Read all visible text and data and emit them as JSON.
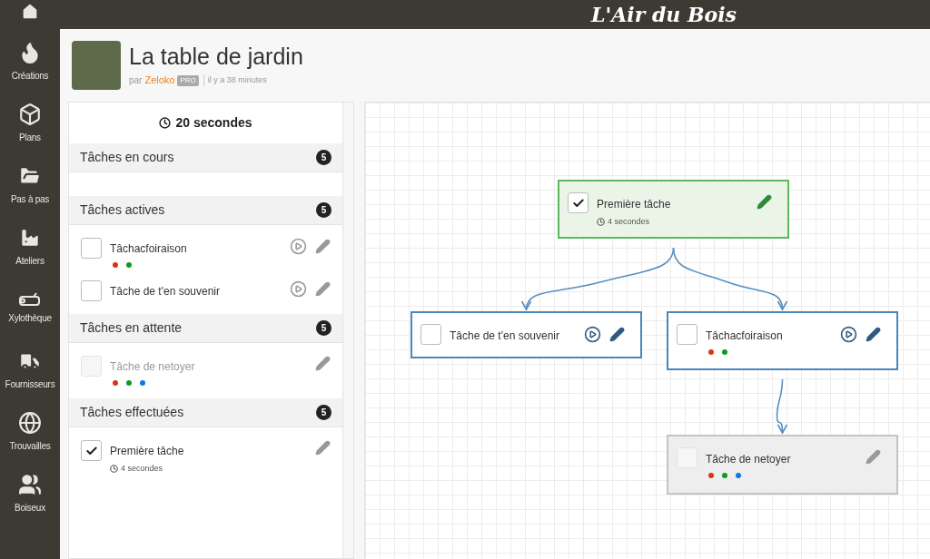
{
  "topbar": {
    "logo": "L'Air du Bois"
  },
  "sidebar": {
    "items": [
      {
        "kind": "home"
      },
      {
        "kind": "flame",
        "label": "Créations"
      },
      {
        "kind": "box",
        "label": "Plans"
      },
      {
        "kind": "folder",
        "label": "Pas à pas"
      },
      {
        "kind": "factory",
        "label": "Ateliers"
      },
      {
        "kind": "log",
        "label": "Xylothèque"
      },
      {
        "kind": "truck",
        "label": "Fournisseurs"
      },
      {
        "kind": "globe",
        "label": "Trouvailles"
      },
      {
        "kind": "users",
        "label": "Boiseux"
      }
    ]
  },
  "project": {
    "title": "La table de jardin",
    "by": "par",
    "author": "Zeloko",
    "badge": "PRO",
    "time": "il y a 38 minutes"
  },
  "timer": "20 secondes",
  "sections": [
    {
      "title": "Tâches en cours",
      "count": "5"
    },
    {
      "title": "Tâches actives",
      "count": "5",
      "tasks": [
        {
          "name": "Tâchacfoiraison",
          "kind": "active",
          "checked": false,
          "dots": [
            {
              "color": "#dd3311"
            },
            {
              "color": "#119922"
            }
          ]
        },
        {
          "name": "Tâche de t'en souvenir",
          "kind": "active",
          "checked": false
        }
      ]
    },
    {
      "title": "Tâches en attente",
      "count": "5",
      "tasks": [
        {
          "name": "Tâche de netoyer",
          "kind": "pending",
          "checked": false,
          "dots": [
            {
              "color": "#dd3311"
            },
            {
              "color": "#119922"
            },
            {
              "color": "#1177dd"
            }
          ]
        }
      ]
    },
    {
      "title": "Tâches effectuées",
      "count": "5",
      "tasks": [
        {
          "name": "Première tâche",
          "kind": "done",
          "checked": true,
          "duration": "4 secondes"
        }
      ]
    }
  ],
  "graph": {
    "nodes": [
      {
        "name": "Première tâche",
        "kind": "done",
        "checked": true,
        "duration": "4 secondes"
      },
      {
        "name": "Tâche de t'en souvenir",
        "kind": "active",
        "checked": false
      },
      {
        "name": "Tâchacfoiraison",
        "kind": "active",
        "checked": false,
        "dots": [
          {
            "color": "#dd3311"
          },
          {
            "color": "#119922"
          }
        ]
      },
      {
        "name": "Tâche de netoyer",
        "kind": "pending",
        "checked": false,
        "dots": [
          {
            "color": "#dd3311"
          },
          {
            "color": "#119922"
          },
          {
            "color": "#1177dd"
          }
        ]
      }
    ]
  }
}
